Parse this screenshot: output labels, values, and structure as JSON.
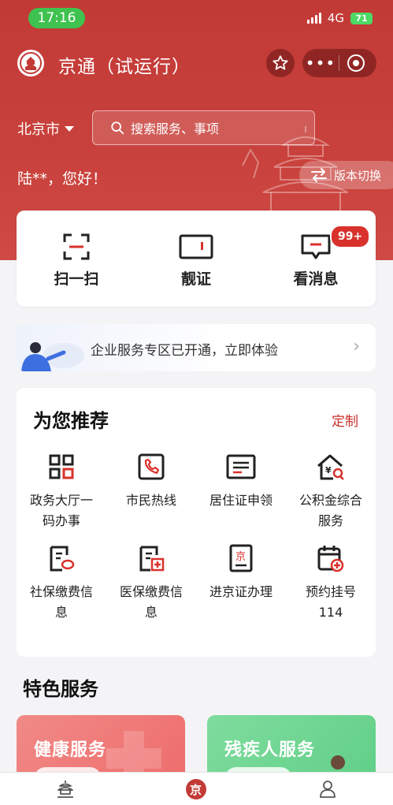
{
  "status_bar": {
    "time": "17:16",
    "network": "4G",
    "battery": "71"
  },
  "header": {
    "app_title": "京通（试运行）"
  },
  "location": {
    "city": "北京市"
  },
  "search": {
    "placeholder": "搜索服务、事项"
  },
  "greeting": "陆**，您好！",
  "version_switch": "版本切换",
  "quick_actions": [
    {
      "label": "扫一扫",
      "icon": "scan-icon"
    },
    {
      "label": "靓证",
      "icon": "card-icon"
    },
    {
      "label": "看消息",
      "icon": "message-icon",
      "badge": "99+"
    }
  ],
  "banner": {
    "text": "企业服务专区已开通，立即体验"
  },
  "recommend": {
    "title": "为您推荐",
    "customize": "定制",
    "items": [
      {
        "label": "政务大厅一码办事",
        "icon": "qrcode-icon"
      },
      {
        "label": "市民热线",
        "icon": "phone-icon"
      },
      {
        "label": "居住证申领",
        "icon": "id-card-icon"
      },
      {
        "label": "公积金综合服务",
        "icon": "house-fund-icon"
      },
      {
        "label": "社保缴费信息",
        "icon": "social-security-icon"
      },
      {
        "label": "医保缴费信息",
        "icon": "medical-insurance-icon"
      },
      {
        "label": "进京证办理",
        "icon": "beijing-permit-icon"
      },
      {
        "label": "预约挂号114",
        "icon": "calendar-add-icon"
      }
    ]
  },
  "featured": {
    "title": "特色服务",
    "cards": [
      {
        "label": "健康服务",
        "color": "#ee6b6b"
      },
      {
        "label": "残疾人服务",
        "color": "#5fcf86"
      }
    ]
  },
  "tabbar": {
    "items": [
      "home-icon",
      "jingtong-icon",
      "profile-icon"
    ]
  },
  "colors": {
    "brand_red": "#c23a36",
    "accent": "#c8312c",
    "badge": "#d9322c"
  }
}
